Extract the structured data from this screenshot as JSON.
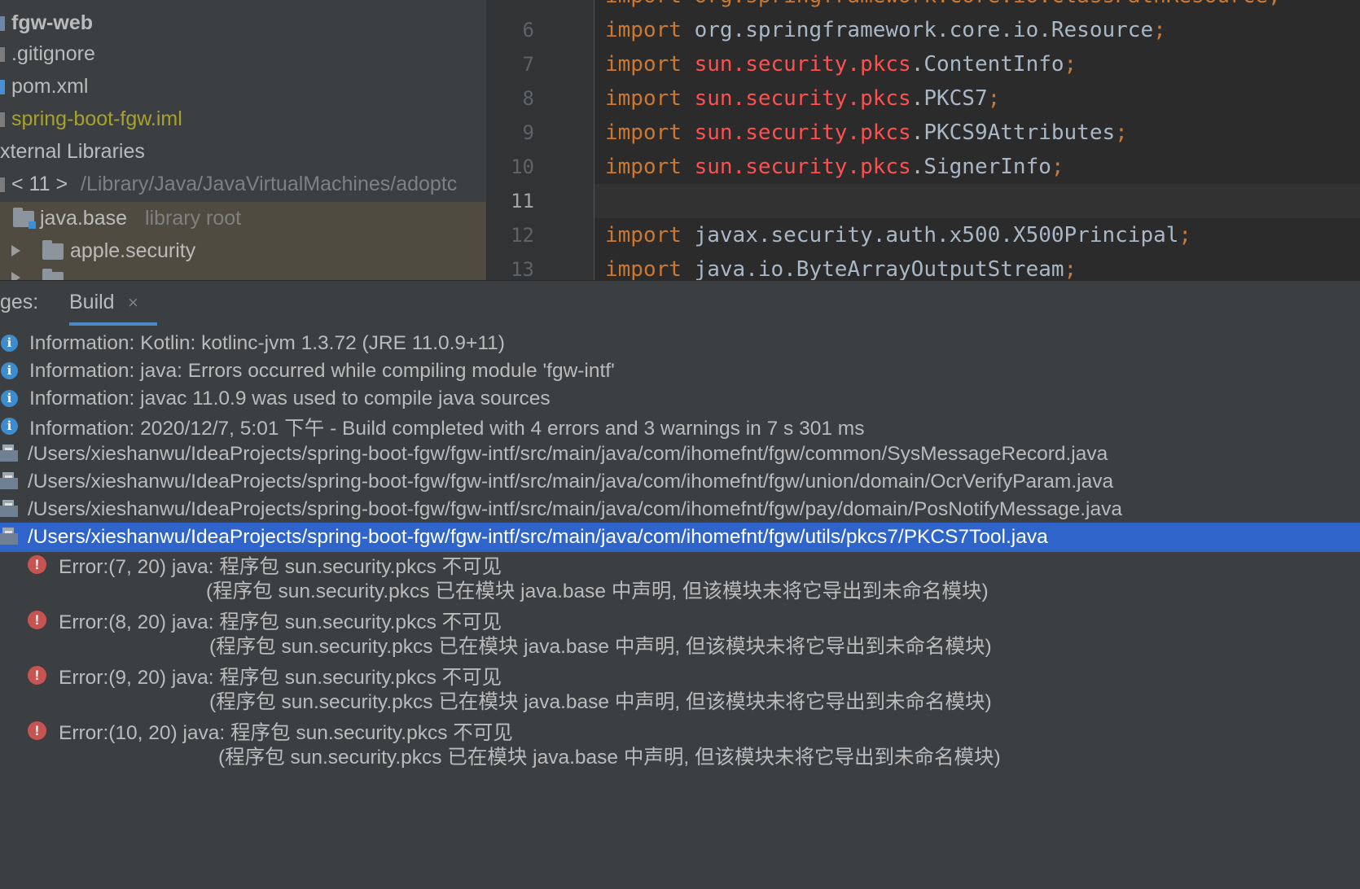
{
  "project_tree": {
    "rows": [
      {
        "label": "fgw-web"
      },
      {
        "label": ".gitignore"
      },
      {
        "label": "pom.xml"
      },
      {
        "label": "spring-boot-fgw.iml"
      },
      {
        "label": "xternal Libraries"
      },
      {
        "prefix": "< 11 >",
        "label": "/Library/Java/JavaVirtualMachines/adoptc"
      },
      {
        "label": "java.base",
        "suffix": "library root"
      },
      {
        "label": "apple.security"
      }
    ]
  },
  "editor": {
    "line_numbers": [
      "6",
      "7",
      "8",
      "9",
      "10",
      "11",
      "12",
      "13"
    ],
    "top_partial": "import org.springframework.core.io.ClassPathResource;",
    "lines": [
      {
        "kw": "import",
        "pkg": "org.springframework.core.io.Resource",
        "semi": ";"
      },
      {
        "kw": "import",
        "err": "sun.security.pkcs",
        "cls": ".ContentInfo",
        "semi": ";"
      },
      {
        "kw": "import",
        "err": "sun.security.pkcs",
        "cls": ".PKCS7",
        "semi": ";"
      },
      {
        "kw": "import",
        "err": "sun.security.pkcs",
        "cls": ".PKCS9Attributes",
        "semi": ";"
      },
      {
        "kw": "import",
        "err": "sun.security.pkcs",
        "cls": ".SignerInfo",
        "semi": ";"
      },
      {
        "kw": "",
        "pkg": "",
        "semi": ""
      },
      {
        "kw": "import",
        "pkg": "javax.security.auth.x500.X500Principal",
        "semi": ";"
      },
      {
        "kw": "import",
        "pkg": "java.io.ByteArrayOutputStream",
        "semi": ";"
      }
    ]
  },
  "toolwindow": {
    "tab_prefix": "ges:",
    "active_tab": "Build",
    "close_glyph": "×"
  },
  "messages": {
    "info": [
      "Information: Kotlin: kotlinc-jvm 1.3.72 (JRE 11.0.9+11)",
      "Information: java: Errors occurred while compiling module 'fgw-intf'",
      "Information: javac 11.0.9 was used to compile java sources",
      "Information: 2020/12/7, 5:01 下午 - Build completed with 4 errors and 3 warnings in 7 s 301 ms"
    ],
    "files": [
      "/Users/xieshanwu/IdeaProjects/spring-boot-fgw/fgw-intf/src/main/java/com/ihomefnt/fgw/common/SysMessageRecord.java",
      "/Users/xieshanwu/IdeaProjects/spring-boot-fgw/fgw-intf/src/main/java/com/ihomefnt/fgw/union/domain/OcrVerifyParam.java",
      "/Users/xieshanwu/IdeaProjects/spring-boot-fgw/fgw-intf/src/main/java/com/ihomefnt/fgw/pay/domain/PosNotifyMessage.java",
      "/Users/xieshanwu/IdeaProjects/spring-boot-fgw/fgw-intf/src/main/java/com/ihomefnt/fgw/utils/pkcs7/PKCS7Tool.java"
    ],
    "errors": [
      {
        "head": "Error:(7, 20)  java: 程序包 sun.security.pkcs 不可见",
        "detail": "(程序包 sun.security.pkcs 已在模块 java.base 中声明, 但该模块未将它导出到未命名模块)"
      },
      {
        "head": "Error:(8, 20)  java: 程序包 sun.security.pkcs 不可见",
        "detail": "(程序包 sun.security.pkcs 已在模块 java.base 中声明, 但该模块未将它导出到未命名模块)"
      },
      {
        "head": "Error:(9, 20)  java: 程序包 sun.security.pkcs 不可见",
        "detail": "(程序包 sun.security.pkcs 已在模块 java.base 中声明, 但该模块未将它导出到未命名模块)"
      },
      {
        "head": "Error:(10, 20)  java: 程序包 sun.security.pkcs 不可见",
        "detail": "(程序包 sun.security.pkcs 已在模块 java.base 中声明, 但该模块未将它导出到未命名模块)"
      }
    ]
  },
  "colors": {
    "keyword": "#cc7832",
    "error_text": "#ff4f4f",
    "selection": "#2f65ca",
    "info_icon": "#3d8cce",
    "error_icon": "#c75450"
  }
}
